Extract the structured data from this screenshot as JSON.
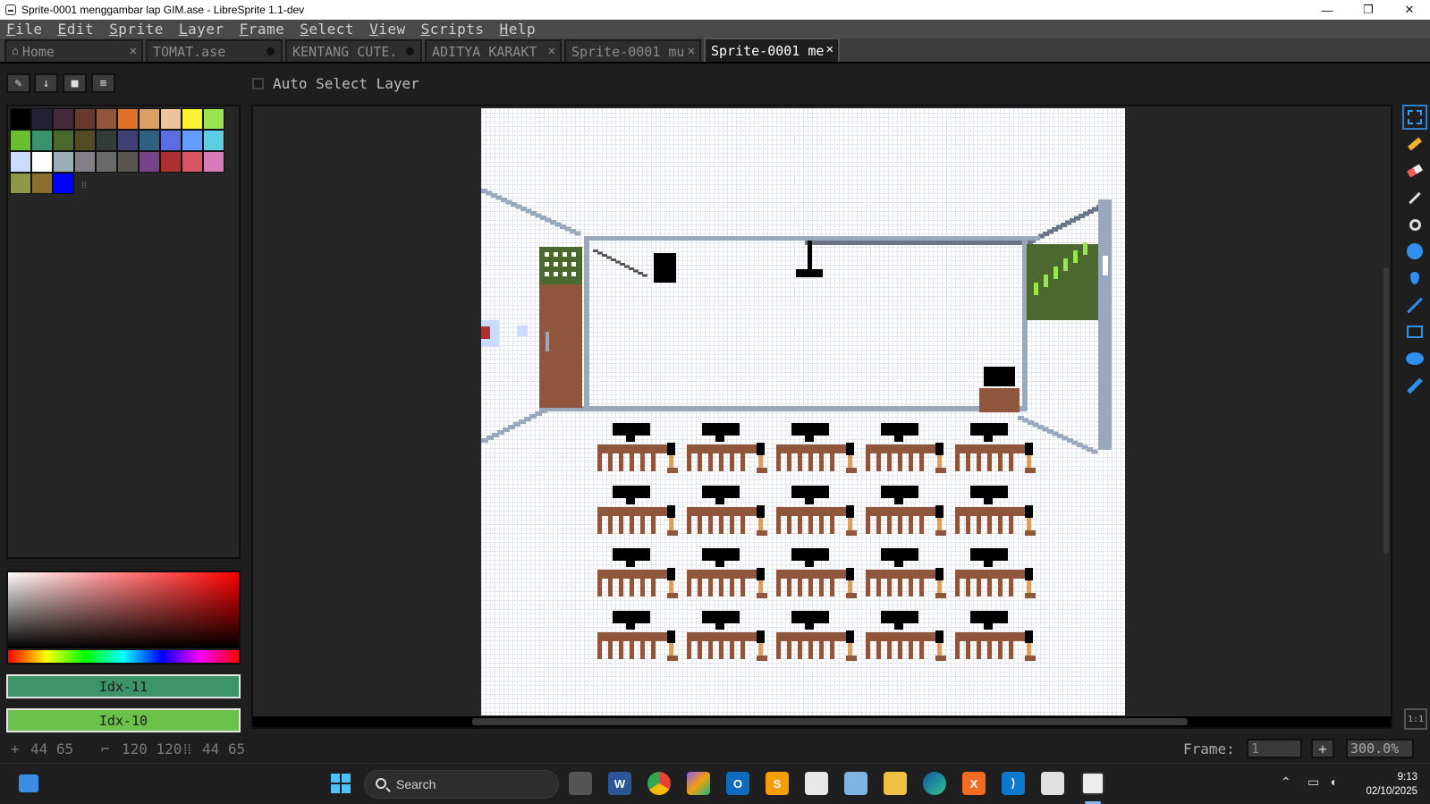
{
  "window": {
    "title": "Sprite-0001 menggambar lap GIM.ase - LibreSprite 1.1-dev",
    "minimize": "—",
    "maximize": "❐",
    "close": "✕"
  },
  "menus": [
    "File",
    "Edit",
    "Sprite",
    "Layer",
    "Frame",
    "Select",
    "View",
    "Scripts",
    "Help"
  ],
  "tabs": [
    {
      "label": "Home",
      "state": "close"
    },
    {
      "label": "TOMAT.ase",
      "state": "modified"
    },
    {
      "label": "KENTANG CUTE.",
      "state": "modified"
    },
    {
      "label": "ADITYA KARAKT",
      "state": "close"
    },
    {
      "label": "Sprite-0001 mu",
      "state": "close"
    },
    {
      "label": "Sprite-0001 me",
      "state": "active"
    }
  ],
  "toolbar": {
    "auto_select_label": "Auto Select Layer"
  },
  "palette": {
    "colors": [
      "#000000",
      "#222034",
      "#45283c",
      "#663931",
      "#8f563b",
      "#df7126",
      "#d9a066",
      "#eec39a",
      "#fbf236",
      "#99e550",
      "#6abe30",
      "#37946e",
      "#4b692f",
      "#524b24",
      "#323c39",
      "#3f3f74",
      "#306082",
      "#5b6ee1",
      "#639bff",
      "#5fcde4",
      "#cbdbfc",
      "#ffffff",
      "#9badb7",
      "#847e87",
      "#696a6a",
      "#595652",
      "#76428a",
      "#ac3232",
      "#d95763",
      "#d77bba",
      "#8f974a",
      "#8a6f30",
      "#0000ff"
    ]
  },
  "colors": {
    "foreground_label": "Idx-11",
    "background_label": "Idx-10",
    "foreground": "#3d9469",
    "background": "#6cc14a"
  },
  "status": {
    "cursor_pos": "44 65",
    "sprite_size": "120 120",
    "selection": "44 65",
    "frame_label": "Frame:",
    "frame_value": "1",
    "frame_add": "+",
    "zoom": "300.0%",
    "zoom_reset": "1:1"
  },
  "taskbar": {
    "search_label": "Search",
    "time": "9:13",
    "date": "02/10/2025"
  }
}
